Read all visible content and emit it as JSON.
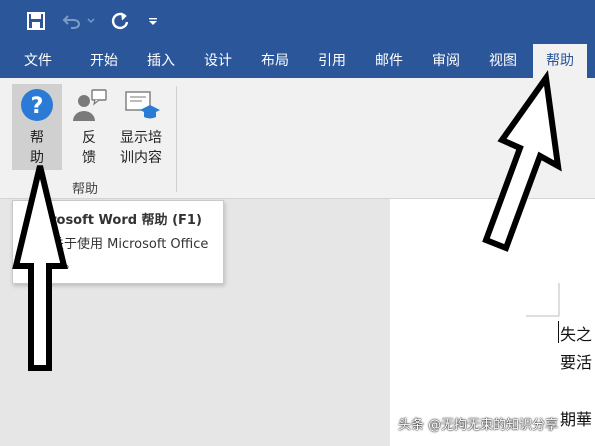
{
  "quick_access": {
    "save_icon": "save-icon",
    "undo_icon": "undo-icon",
    "redo_icon": "redo-icon",
    "customize_icon": "customize-dropdown-icon"
  },
  "tabs": [
    "文件",
    "开始",
    "插入",
    "设计",
    "布局",
    "引用",
    "邮件",
    "审阅",
    "视图",
    "帮助"
  ],
  "active_tab": "帮助",
  "ribbon": {
    "group_label": "帮助",
    "buttons": [
      {
        "label_line1": "帮",
        "label_line2": "助",
        "icon": "help-icon"
      },
      {
        "label_line1": "反",
        "label_line2": "馈",
        "icon": "feedback-icon"
      },
      {
        "label_line1": "显示培",
        "label_line2": "训内容",
        "icon": "training-icon"
      }
    ]
  },
  "tooltip": {
    "title": "Microsoft Word 帮助 (F1)",
    "description": "获取关于使用 Microsoft Office 的帮助。"
  },
  "document": {
    "lines": [
      "失之",
      "要活",
      "期華"
    ]
  },
  "watermark": "头条 @无拘无束的知识分享",
  "colors": {
    "ribbon_blue": "#2b579a",
    "ribbon_bg": "#f1f1f1",
    "help_icon_blue": "#2b7bd6"
  }
}
